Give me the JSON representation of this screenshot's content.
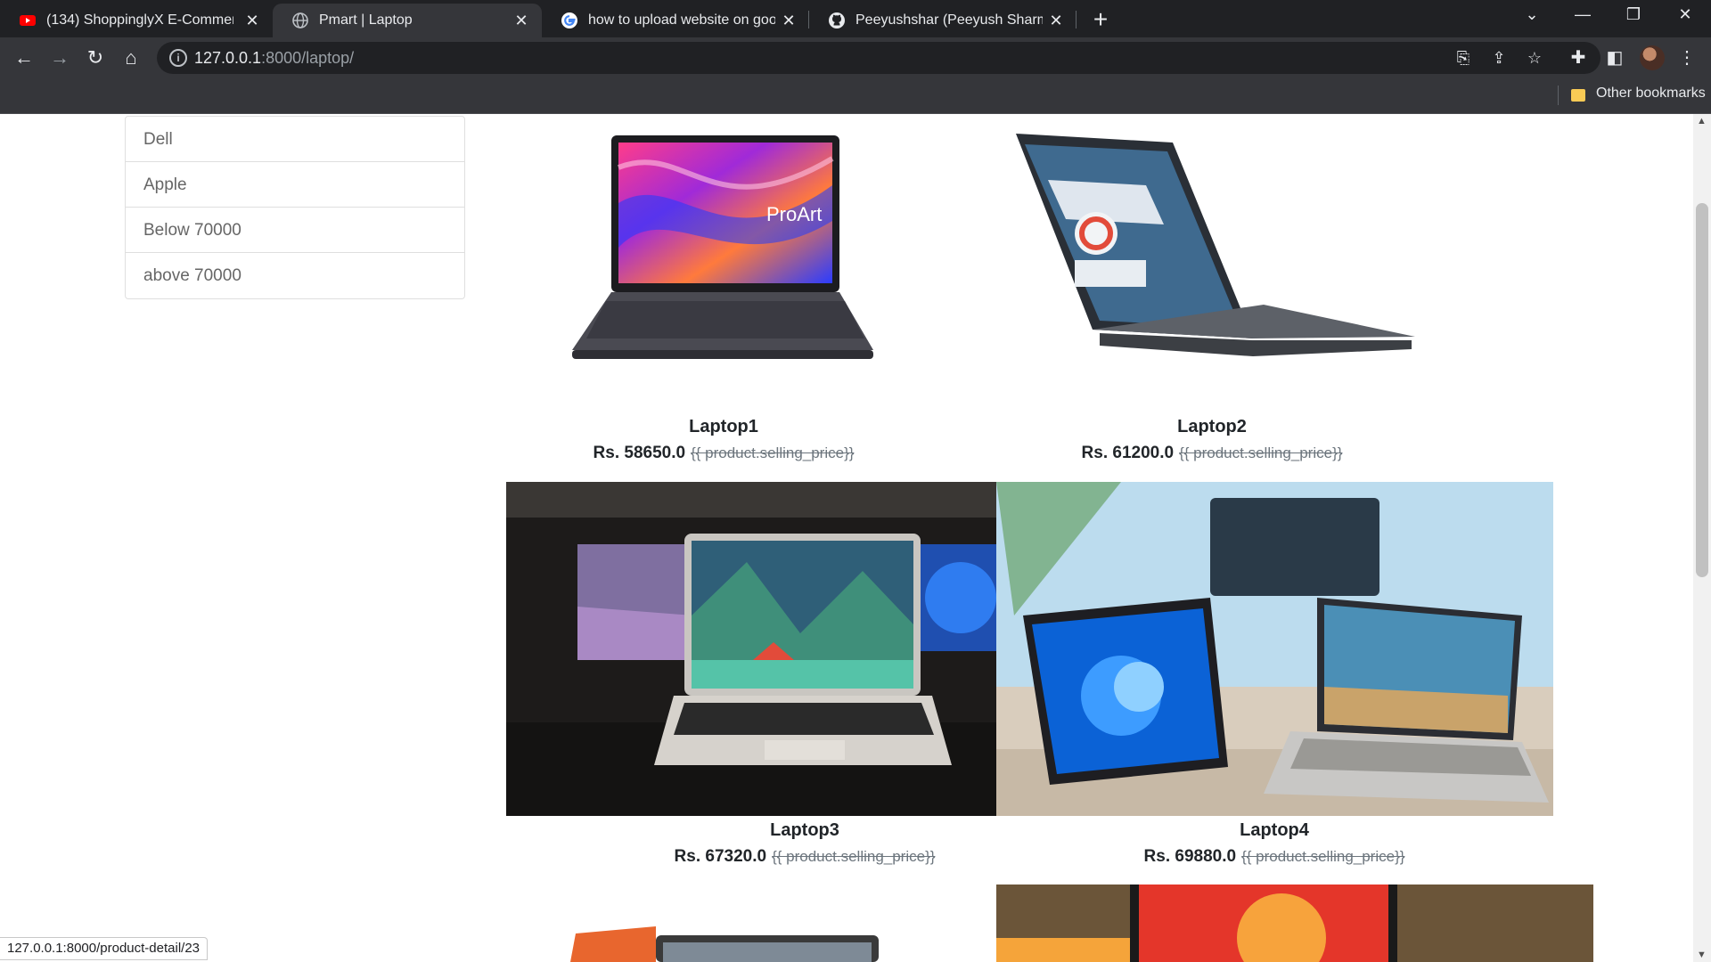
{
  "browser": {
    "tabs": [
      {
        "title": "(134) ShoppinglyX E-Commerce",
        "icon": "youtube-icon"
      },
      {
        "title": "Pmart | Laptop",
        "icon": "globe-icon",
        "active": true
      },
      {
        "title": "how to upload website on googl",
        "icon": "google-icon"
      },
      {
        "title": "Peeyushshar (Peeyush Sharma) · G",
        "icon": "github-icon"
      }
    ],
    "url_host": "127.0.0.1",
    "url_path": ":8000/laptop/",
    "bookmarks_label": "Other bookmarks",
    "status_url": "127.0.0.1:8000/product-detail/23"
  },
  "filters": [
    "Dell",
    "Apple",
    "Below 70000",
    "above 70000"
  ],
  "products": [
    {
      "name": "Laptop1",
      "price": "Rs. 58650.0",
      "strike": "{{ product.selling_price}}"
    },
    {
      "name": "Laptop2",
      "price": "Rs. 61200.0",
      "strike": "{{ product.selling_price}}"
    },
    {
      "name": "Laptop3",
      "price": "Rs. 67320.0",
      "strike": "{{ product.selling_price}}"
    },
    {
      "name": "Laptop4",
      "price": "Rs. 69880.0",
      "strike": "{{ product.selling_price}}"
    }
  ],
  "colors": {
    "chrome_bg": "#202124",
    "toolbar_bg": "#35363a",
    "text": "#212529"
  }
}
